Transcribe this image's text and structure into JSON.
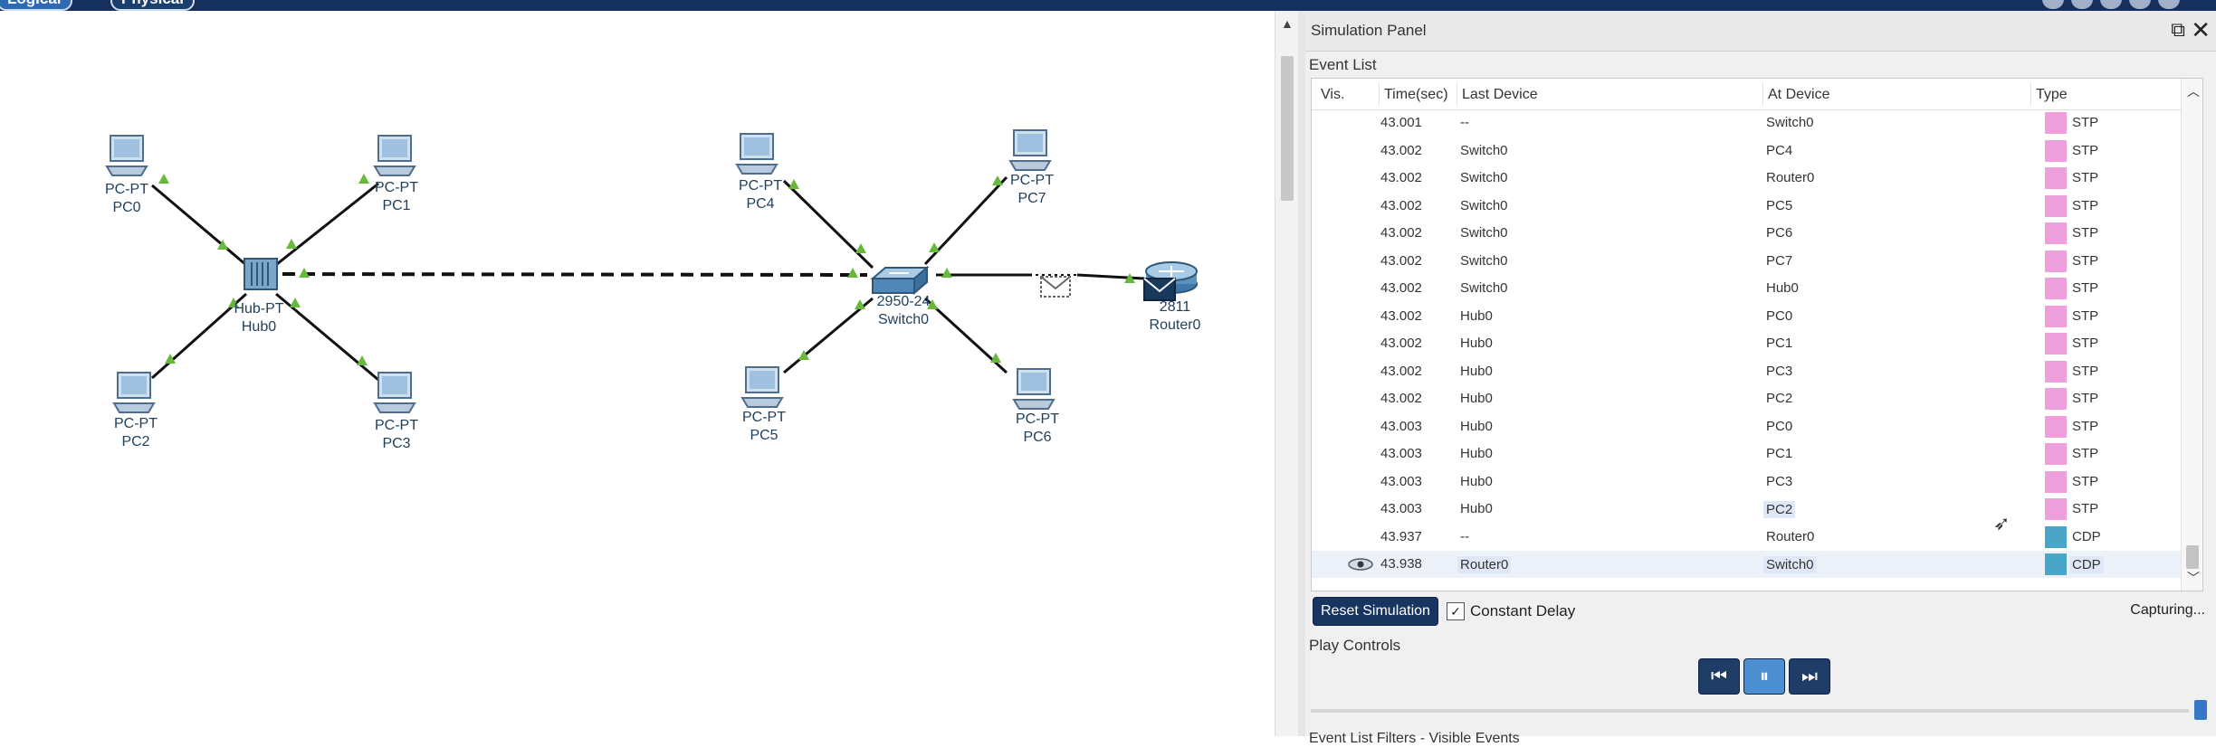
{
  "topbar": {
    "logical_tab": "Logical",
    "physical_tab": "Physical"
  },
  "topology": {
    "devices": [
      {
        "id": "PC0",
        "type": "PC-PT",
        "name": "PC0"
      },
      {
        "id": "PC1",
        "type": "PC-PT",
        "name": "PC1"
      },
      {
        "id": "PC2",
        "type": "PC-PT",
        "name": "PC2"
      },
      {
        "id": "PC3",
        "type": "PC-PT",
        "name": "PC3"
      },
      {
        "id": "Hub0",
        "type": "Hub-PT",
        "name": "Hub0"
      },
      {
        "id": "PC4",
        "type": "PC-PT",
        "name": "PC4"
      },
      {
        "id": "PC7",
        "type": "PC-PT",
        "name": "PC7"
      },
      {
        "id": "PC5",
        "type": "PC-PT",
        "name": "PC5"
      },
      {
        "id": "PC6",
        "type": "PC-PT",
        "name": "PC6"
      },
      {
        "id": "Switch0",
        "type": "2950-24",
        "name": "Switch0"
      },
      {
        "id": "Router0",
        "type": "2811",
        "name": "Router0"
      }
    ]
  },
  "panel": {
    "title": "Simulation Panel",
    "event_list_label": "Event List",
    "columns": {
      "vis": "Vis.",
      "time": "Time(sec)",
      "last": "Last Device",
      "at": "At Device",
      "type": "Type"
    },
    "rows": [
      {
        "time": "43.001",
        "last": "--",
        "at": "Switch0",
        "type": "STP",
        "color": "#ef9fdc"
      },
      {
        "time": "43.002",
        "last": "Switch0",
        "at": "PC4",
        "type": "STP",
        "color": "#ef9fdc"
      },
      {
        "time": "43.002",
        "last": "Switch0",
        "at": "Router0",
        "type": "STP",
        "color": "#ef9fdc"
      },
      {
        "time": "43.002",
        "last": "Switch0",
        "at": "PC5",
        "type": "STP",
        "color": "#ef9fdc"
      },
      {
        "time": "43.002",
        "last": "Switch0",
        "at": "PC6",
        "type": "STP",
        "color": "#ef9fdc"
      },
      {
        "time": "43.002",
        "last": "Switch0",
        "at": "PC7",
        "type": "STP",
        "color": "#ef9fdc"
      },
      {
        "time": "43.002",
        "last": "Switch0",
        "at": "Hub0",
        "type": "STP",
        "color": "#ef9fdc"
      },
      {
        "time": "43.002",
        "last": "Hub0",
        "at": "PC0",
        "type": "STP",
        "color": "#ef9fdc"
      },
      {
        "time": "43.002",
        "last": "Hub0",
        "at": "PC1",
        "type": "STP",
        "color": "#ef9fdc"
      },
      {
        "time": "43.002",
        "last": "Hub0",
        "at": "PC3",
        "type": "STP",
        "color": "#ef9fdc"
      },
      {
        "time": "43.002",
        "last": "Hub0",
        "at": "PC2",
        "type": "STP",
        "color": "#ef9fdc"
      },
      {
        "time": "43.003",
        "last": "Hub0",
        "at": "PC0",
        "type": "STP",
        "color": "#ef9fdc"
      },
      {
        "time": "43.003",
        "last": "Hub0",
        "at": "PC1",
        "type": "STP",
        "color": "#ef9fdc"
      },
      {
        "time": "43.003",
        "last": "Hub0",
        "at": "PC3",
        "type": "STP",
        "color": "#ef9fdc"
      },
      {
        "time": "43.003",
        "last": "Hub0",
        "at": "PC2",
        "type": "STP",
        "color": "#ef9fdc"
      },
      {
        "time": "43.937",
        "last": "--",
        "at": "Router0",
        "type": "CDP",
        "color": "#4aa6c8"
      },
      {
        "time": "43.938",
        "last": "Router0",
        "at": "Switch0",
        "type": "CDP",
        "color": "#4aa6c8"
      }
    ],
    "reset_label": "Reset Simulation",
    "constant_delay_label": "Constant Delay",
    "constant_delay_checked": "✓",
    "capturing_label": "Capturing...",
    "play_controls_label": "Play Controls",
    "filters_label": "Event List Filters - Visible Events"
  }
}
